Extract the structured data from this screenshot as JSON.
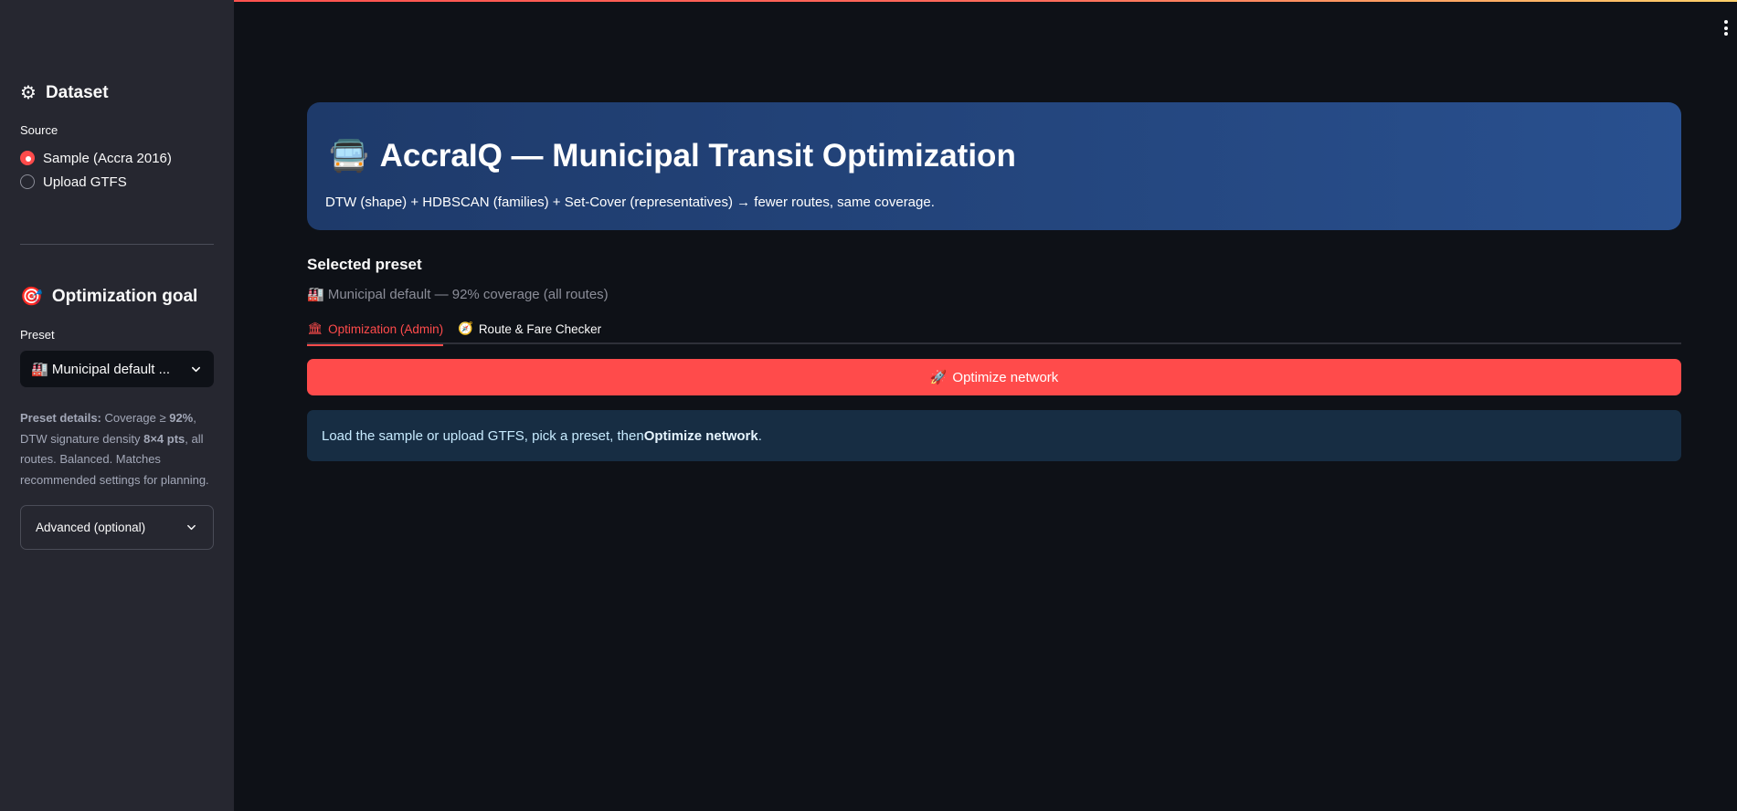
{
  "sidebar": {
    "dataset": {
      "title": "Dataset",
      "icon": "gear-icon",
      "source_label": "Source",
      "options": [
        "Sample (Accra 2016)",
        "Upload GTFS"
      ],
      "selected_index": 0
    },
    "goal": {
      "title": "Optimization goal",
      "icon": "target-icon",
      "preset_label": "Preset",
      "preset_value": "🏭 Municipal default ...",
      "details_prefix": "Preset details:",
      "details_text_1": " Coverage ≥ ",
      "details_cov": "92%",
      "details_text_2": ", DTW signature density ",
      "details_density": "8×4 pts",
      "details_text_3": ", all routes. Balanced. Matches recommended settings for planning.",
      "advanced_label": "Advanced (optional)"
    }
  },
  "hero": {
    "icon": "🚍",
    "title": "AccraIQ — Municipal Transit Optimization",
    "subtitle": "DTW (shape) + HDBSCAN (families) + Set-Cover (representatives) → fewer routes, same coverage."
  },
  "main": {
    "selected_preset_label": "Selected preset",
    "selected_preset_value": "🏭 Municipal default — 92% coverage (all routes)",
    "tabs": [
      {
        "icon": "🏛",
        "label": "Optimization (Admin)",
        "active": true
      },
      {
        "icon": "🧭",
        "label": "Route & Fare Checker",
        "active": false
      }
    ],
    "optimize_button": {
      "icon": "🚀",
      "label": "Optimize network"
    },
    "info": {
      "text_before": "Load the sample or upload GTFS, pick a preset, then ",
      "text_bold": "Optimize network",
      "text_after": "."
    }
  },
  "colors": {
    "accent": "#ff4b4b",
    "background": "#0e1117",
    "sidebar": "#262730",
    "hero_start": "#1e3a6a",
    "hero_end": "#29508f",
    "info_bg": "#172d43"
  }
}
